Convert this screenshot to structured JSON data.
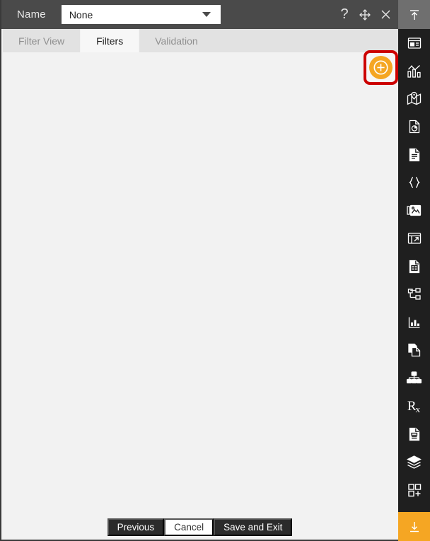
{
  "header": {
    "name_label": "Name",
    "name_value": "None",
    "name_placeholder": "None",
    "icons": {
      "help": "?",
      "move": "move-icon",
      "close": "close-icon"
    }
  },
  "tabs": [
    {
      "label": "Filter View",
      "active": false
    },
    {
      "label": "Filters",
      "active": true
    },
    {
      "label": "Validation",
      "active": false
    }
  ],
  "toolbar": {
    "add_label": "+",
    "add_icon": "add-circle-icon",
    "highlight_color": "#cc0000",
    "accent_color": "#f5a623"
  },
  "footer": {
    "previous_label": "Previous",
    "cancel_label": "Cancel",
    "save_label": "Save and Exit"
  },
  "rail": {
    "top_icon": "collapse-up-icon",
    "bottom_icon": "collapse-down-icon",
    "items": [
      {
        "icon": "panel-layout-icon"
      },
      {
        "icon": "bar-line-chart-icon"
      },
      {
        "icon": "map-pin-icon"
      },
      {
        "icon": "document-pie-chart-icon"
      },
      {
        "icon": "document-text-icon"
      },
      {
        "icon": "curly-braces-icon"
      },
      {
        "icon": "image-gallery-icon"
      },
      {
        "icon": "window-export-icon"
      },
      {
        "icon": "document-table-icon"
      },
      {
        "icon": "hierarchy-tree-icon"
      },
      {
        "icon": "bar-chart-axes-icon"
      },
      {
        "icon": "copy-documents-icon"
      },
      {
        "icon": "org-cluster-icon"
      },
      {
        "icon": "prescription-rx-icon"
      },
      {
        "icon": "document-report-icon"
      },
      {
        "icon": "layers-stack-icon"
      },
      {
        "icon": "add-widget-icon"
      }
    ]
  },
  "colors": {
    "header_bg": "#4a4a4a",
    "panel_bg": "#f2f2f2",
    "tab_inactive_bg": "#e2e2e2",
    "tab_active_bg": "#f7f7f7",
    "rail_bg": "#1f1f1f",
    "rail_top_bg": "#6f6f6f",
    "accent": "#f5a623",
    "highlight": "#cc0000",
    "button_dark": "#2b2b2b"
  }
}
